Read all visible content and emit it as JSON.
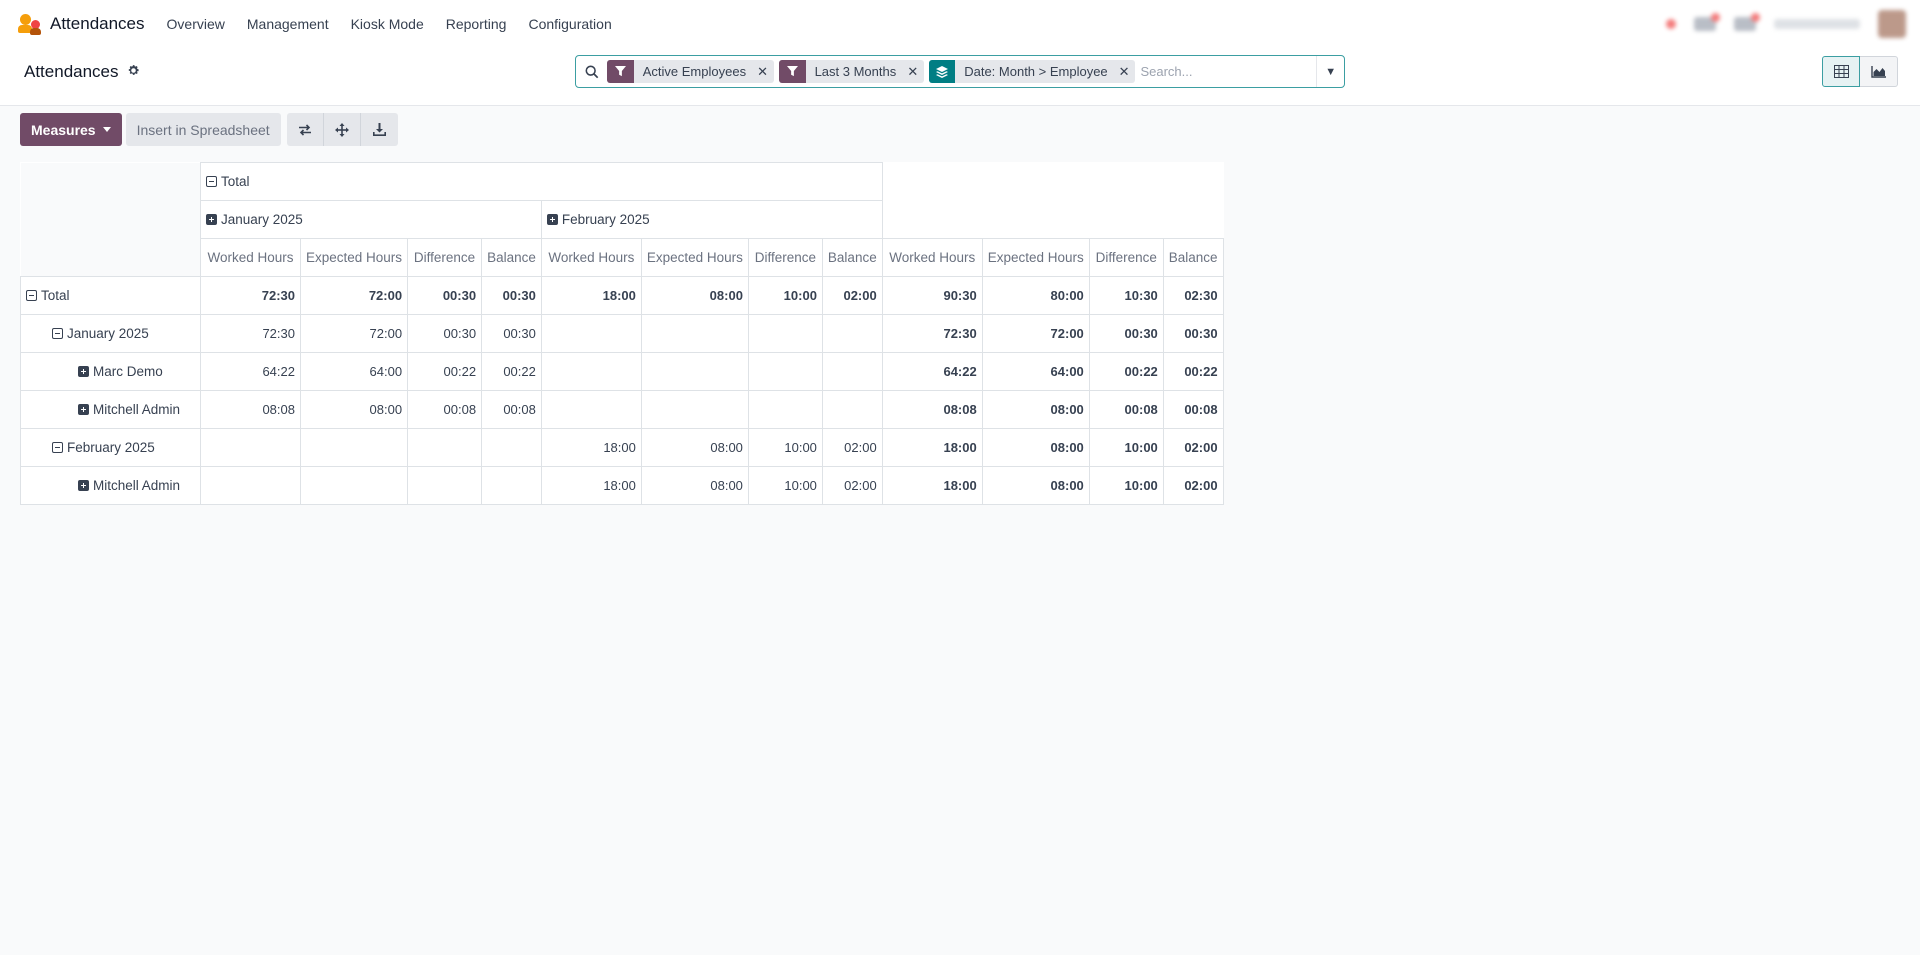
{
  "navbar": {
    "app_title": "Attendances",
    "menu": [
      "Overview",
      "Management",
      "Kiosk Mode",
      "Reporting",
      "Configuration"
    ]
  },
  "control_panel": {
    "breadcrumb": "Attendances",
    "facets": [
      {
        "type": "filter",
        "label": "Active Employees"
      },
      {
        "type": "filter",
        "label": "Last 3 Months"
      },
      {
        "type": "group",
        "label": "Date: Month > Employee"
      }
    ],
    "search_placeholder": "Search..."
  },
  "toolbar": {
    "measures_label": "Measures",
    "insert_label": "Insert in Spreadsheet"
  },
  "pivot": {
    "col_total_label": "Total",
    "col_groups": [
      "January 2025",
      "February 2025"
    ],
    "measures": [
      "Worked Hours",
      "Expected Hours",
      "Difference",
      "Balance"
    ],
    "rows": [
      {
        "label": "Total",
        "level": 0,
        "expander": "minus",
        "values": [
          "72:30",
          "72:00",
          "00:30",
          "00:30",
          "18:00",
          "08:00",
          "10:00",
          "02:00",
          "90:30",
          "80:00",
          "10:30",
          "02:30"
        ]
      },
      {
        "label": "January 2025",
        "level": 1,
        "expander": "minus",
        "values": [
          "72:30",
          "72:00",
          "00:30",
          "00:30",
          "",
          "",
          "",
          "",
          "72:30",
          "72:00",
          "00:30",
          "00:30"
        ]
      },
      {
        "label": "Marc Demo",
        "level": 2,
        "expander": "plus",
        "values": [
          "64:22",
          "64:00",
          "00:22",
          "00:22",
          "",
          "",
          "",
          "",
          "64:22",
          "64:00",
          "00:22",
          "00:22"
        ]
      },
      {
        "label": "Mitchell Admin",
        "level": 2,
        "expander": "plus",
        "values": [
          "08:08",
          "08:00",
          "00:08",
          "00:08",
          "",
          "",
          "",
          "",
          "08:08",
          "08:00",
          "00:08",
          "00:08"
        ]
      },
      {
        "label": "February 2025",
        "level": 1,
        "expander": "minus",
        "values": [
          "",
          "",
          "",
          "",
          "18:00",
          "08:00",
          "10:00",
          "02:00",
          "18:00",
          "08:00",
          "10:00",
          "02:00"
        ]
      },
      {
        "label": "Mitchell Admin",
        "level": 2,
        "expander": "plus",
        "values": [
          "",
          "",
          "",
          "",
          "18:00",
          "08:00",
          "10:00",
          "02:00",
          "18:00",
          "08:00",
          "10:00",
          "02:00"
        ]
      }
    ]
  },
  "colors": {
    "brand": "#714b67",
    "group_facet": "#017e84",
    "focus": "#3b9ea2"
  }
}
